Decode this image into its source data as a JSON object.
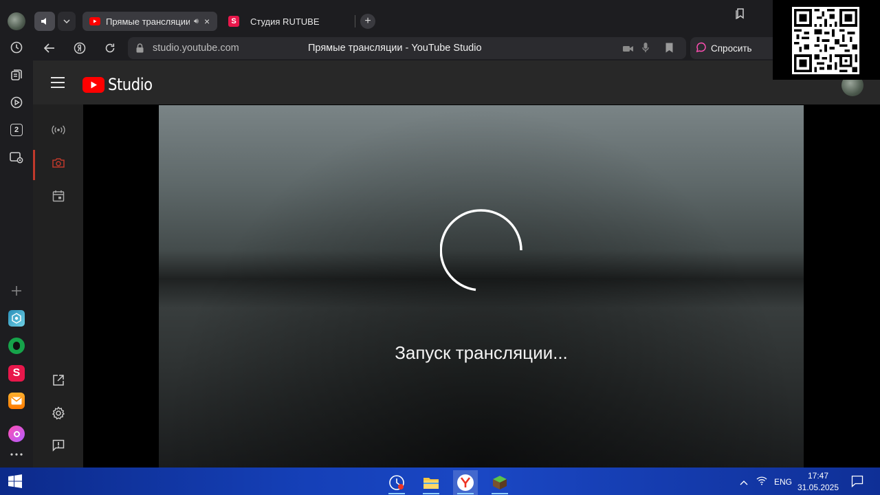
{
  "browser": {
    "tabs": [
      {
        "label": "Прямые трансляции",
        "active": true
      },
      {
        "label": "Студия RUTUBE",
        "active": false
      }
    ],
    "url": "studio.youtube.com",
    "page_title": "Прямые трансляции - YouTube Studio",
    "ask_button": "Спросить",
    "sidebar_badge": "2"
  },
  "studio": {
    "logo_text": "Studio",
    "status_text": "Запуск трансляции..."
  },
  "taskbar": {
    "language": "ENG",
    "time": "17:47",
    "date": "31.05.2025"
  },
  "colors": {
    "youtube_red": "#ff0000",
    "rutube_red": "#e8174b",
    "rail_active": "#c0392b"
  }
}
